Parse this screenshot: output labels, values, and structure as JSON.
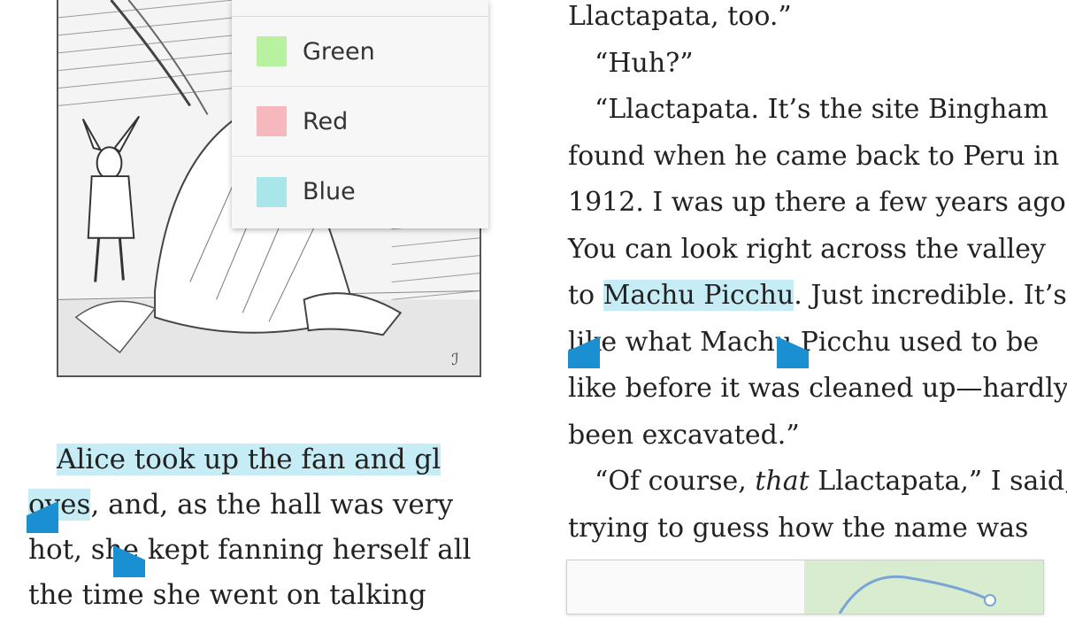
{
  "popup": {
    "items": [
      {
        "label": "Green",
        "color": "#b8f2a0"
      },
      {
        "label": "Red",
        "color": "#f7b8bd"
      },
      {
        "label": "Blue",
        "color": "#a8e6ea"
      }
    ]
  },
  "left_page": {
    "highlighted": "Alice took up the fan and gl",
    "highlight_tail": "oves",
    "rest_line2": ", and, as the hall was very",
    "line3": "hot, she kept fanning herself all",
    "line4": "the time she went on talking"
  },
  "right_page": {
    "lines": [
      "Llactapata, too.”",
      "“Huh?”",
      "“Llactapata. It’s the site Bingham",
      "found when he came back to Peru in",
      "1912. I was up there a few years ago.",
      "You can look right across the valley"
    ],
    "line7_before": "to ",
    "line7_highlight": "Machu Picchu",
    "line7_after": ". Just incredible. It’s",
    "line8": "like what Machu Picchu used to be",
    "line9": "like before it was cleaned up—hardly",
    "line10": "been excavated.”",
    "line11_before": "“Of course, ",
    "line11_italic": "that",
    "line11_after": " Llactapata,” I said,",
    "line12": "trying to guess how the name was"
  },
  "colors": {
    "highlight": "#c6ecf6",
    "handle": "#1a8fd1"
  }
}
